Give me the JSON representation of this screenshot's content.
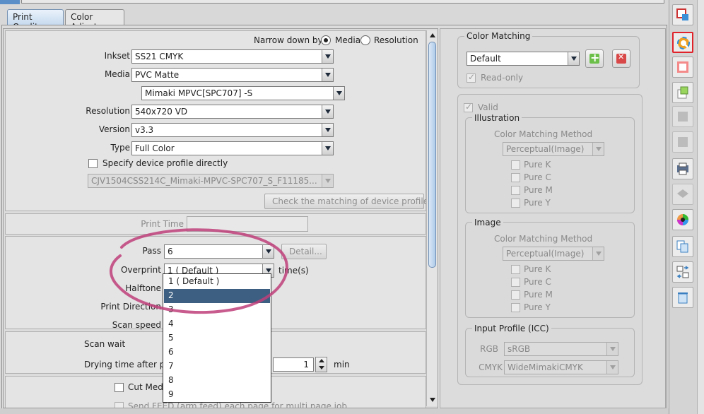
{
  "tabs": [
    {
      "label": "Print Quality",
      "active": true
    },
    {
      "label": "Color Adjust",
      "active": false
    }
  ],
  "left": {
    "narrow_label": "Narrow down by",
    "radio_media": "Media",
    "radio_resolution": "Resolution",
    "inkset_label": "Inkset",
    "inkset_value": "SS21 CMYK",
    "media_label": "Media",
    "media_value": "PVC Matte",
    "media_sub_value": "Mimaki MPVC[SPC707] -S",
    "resolution_label": "Resolution",
    "resolution_value": "540x720 VD",
    "version_label": "Version",
    "version_value": "v3.3",
    "type_label": "Type",
    "type_value": "Full Color",
    "specify_label": "Specify device profile directly",
    "device_profile_value": "CJV1504CSS214C_Mimaki-MPVC-SPC707_S_F11185...",
    "check_button": "Check the matching of device profiles",
    "print_time_label": "Print Time",
    "pass_label": "Pass",
    "pass_value": "6",
    "detail_button": "Detail...",
    "overprint_label": "Overprint",
    "overprint_value": "1 ( Default )",
    "overprint_unit": "time(s)",
    "halftone_label": "Halftone",
    "print_direction_label": "Print Direction",
    "scan_speed_label": "Scan speed",
    "scan_wait_label": "Scan wait",
    "drying_label": "Drying time after prin",
    "drying_value": "1",
    "drying_unit": "min",
    "cut_media_label": "Cut Media",
    "send_feed_label": "Send FEED (arm feed) each page for multi page job"
  },
  "dropdown": {
    "items": [
      "1 ( Default )",
      "2",
      "3",
      "4",
      "5",
      "6",
      "7",
      "8",
      "9"
    ],
    "selected_index": 1
  },
  "right": {
    "color_matching_title": "Color Matching",
    "color_matching_value": "Default",
    "readonly_label": "Read-only",
    "valid_label": "Valid",
    "illustration_title": "Illustration",
    "illus_method_label": "Color Matching Method",
    "illus_method_value": "Perceptual(Image)",
    "illus_pure": [
      "Pure K",
      "Pure C",
      "Pure M",
      "Pure Y"
    ],
    "image_title": "Image",
    "image_method_label": "Color Matching Method",
    "image_method_value": "Perceptual(Image)",
    "image_pure": [
      "Pure K",
      "Pure C",
      "Pure M",
      "Pure Y"
    ],
    "input_profile_title": "Input Profile (ICC)",
    "rgb_label": "RGB",
    "rgb_value": "sRGB",
    "cmyk_label": "CMYK",
    "cmyk_value": "WideMimakiCMYK"
  },
  "colors": {
    "accent": "#3d6082",
    "annotation": "#c0407a",
    "selected_tool_border": "#e0222a"
  }
}
